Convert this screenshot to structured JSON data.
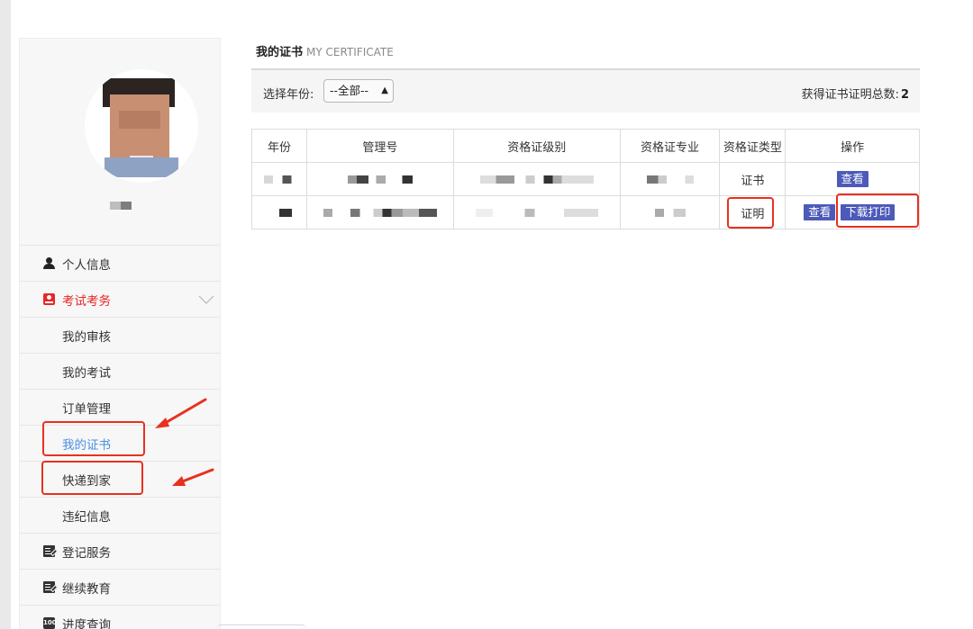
{
  "sidebar": {
    "items": [
      {
        "label": "个人信息",
        "icon": "person-icon"
      },
      {
        "label": "考试考务",
        "icon": "exam-icon",
        "active": true,
        "expanded": true
      },
      {
        "label": "我的审核"
      },
      {
        "label": "我的考试"
      },
      {
        "label": "订单管理"
      },
      {
        "label": "我的证书",
        "current": true
      },
      {
        "label": "快递到家"
      },
      {
        "label": "违纪信息"
      },
      {
        "label": "登记服务",
        "icon": "edit-icon"
      },
      {
        "label": "继续教育",
        "icon": "edit-icon"
      },
      {
        "label": "进度查询",
        "icon": "calendar-icon",
        "icon_text": "100"
      }
    ]
  },
  "main": {
    "title": "我的证书",
    "title_en": "MY CERTIFICATE",
    "filter_label": "选择年份:",
    "year_select_value": "--全部--",
    "total_label": "获得证书证明总数:",
    "total_value": "2",
    "table": {
      "headers": [
        "年份",
        "管理号",
        "资格证级别",
        "资格证专业",
        "资格证类型",
        "操作"
      ],
      "rows": [
        {
          "type": "证书",
          "actions": [
            "查看"
          ]
        },
        {
          "type": "证明",
          "actions": [
            "查看",
            "下载打印"
          ]
        }
      ]
    }
  },
  "colors": {
    "accent_red": "#e62828",
    "link_blue": "#4a8ee0",
    "button_blue": "#4d5ab8",
    "annotation_red": "#e8311f"
  }
}
